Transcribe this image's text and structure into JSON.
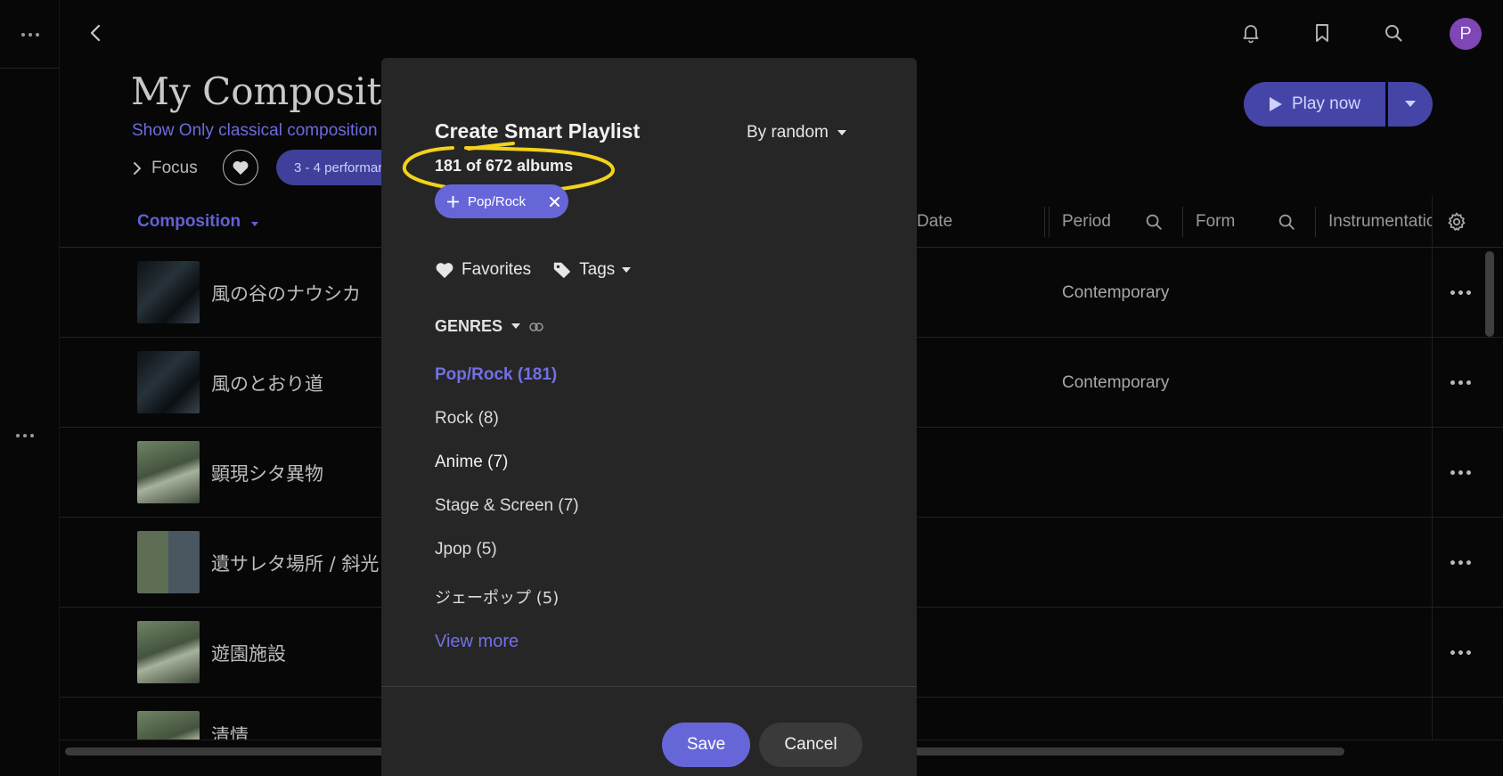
{
  "header": {
    "page_title": "My Compositic",
    "page_subtitle": "Show Only classical composition",
    "focus_label": "Focus",
    "performers_chip": "3 - 4 performar",
    "play_now_label": "Play now",
    "avatar_initial": "P",
    "icons": [
      "back-icon",
      "bell-icon",
      "bookmark-icon",
      "search-icon"
    ]
  },
  "table": {
    "columns": {
      "composition": "Composition",
      "date": "Date",
      "period": "Period",
      "form": "Form",
      "instrumentation": "Instrumentatic"
    },
    "rows": [
      {
        "title": "風の谷のナウシカ",
        "period": "Contemporary"
      },
      {
        "title": "風のとおり道",
        "period": "Contemporary"
      },
      {
        "title": "顕現シタ異物",
        "period": ""
      },
      {
        "title": "遺サレタ場所 / 斜光",
        "period": ""
      },
      {
        "title": "遊園施設",
        "period": ""
      },
      {
        "title": "清情",
        "period": ""
      }
    ]
  },
  "modal": {
    "title": "Create Smart Playlist",
    "sort_label": "By random",
    "album_count": "181 of 672 albums",
    "active_chip": "Pop/Rock",
    "favorites_label": "Favorites",
    "tags_label": "Tags",
    "genres_heading": "GENRES",
    "genres": [
      "Pop/Rock (181)",
      "Rock (8)",
      "Anime (7)",
      "Stage & Screen (7)",
      "Jpop (5)",
      "ジェーポップ (5)"
    ],
    "view_more": "View more",
    "save_label": "Save",
    "cancel_label": "Cancel"
  },
  "colors": {
    "accent": "#6766d9",
    "accent_dark": "#4545a8",
    "highlight": "#f2d21b",
    "modal_bg": "#262626",
    "page_bg": "#070707"
  }
}
